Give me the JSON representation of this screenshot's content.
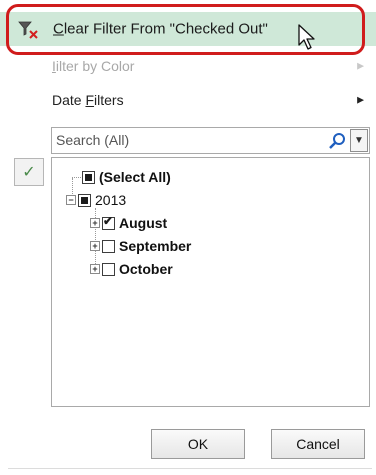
{
  "menu": {
    "clear_filter": {
      "prefix": "",
      "accel": "C",
      "rest": "lear Filter From \"Checked Out\""
    },
    "filter_by_color": {
      "accel": "I",
      "rest": "ilter by Color"
    },
    "date_filters": {
      "lead": "Date ",
      "accel": "F",
      "rest": "ilters"
    }
  },
  "search": {
    "placeholder": "Search (All)"
  },
  "tree": {
    "select_all": "(Select All)",
    "year": "2013",
    "months": [
      "August",
      "September",
      "October"
    ]
  },
  "buttons": {
    "ok": "OK",
    "cancel": "Cancel"
  },
  "colors": {
    "highlight": "#cfe8d8",
    "ring": "#d01c1c"
  }
}
